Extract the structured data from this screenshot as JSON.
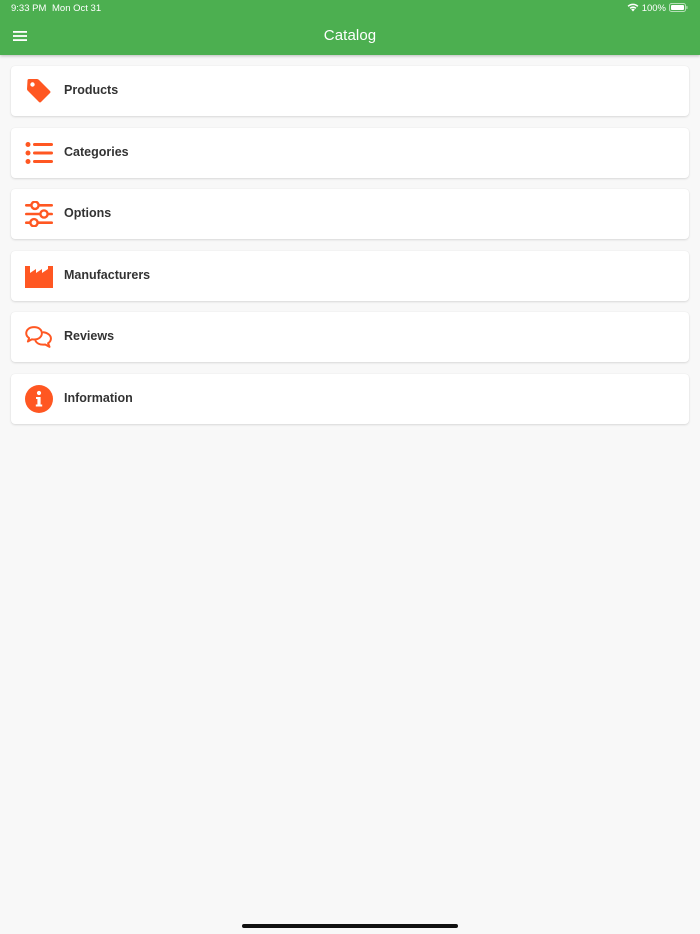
{
  "status_bar": {
    "time": "9:33 PM",
    "date": "Mon Oct 31",
    "battery": "100%",
    "icons": [
      "wifi-icon",
      "battery-icon"
    ]
  },
  "header": {
    "title": "Catalog",
    "menu_icon": "hamburger-menu-icon",
    "background_color": "#4caf50"
  },
  "accent_color": "#ff5722",
  "menu": {
    "items": [
      {
        "label": "Products",
        "icon": "tag-icon"
      },
      {
        "label": "Categories",
        "icon": "list-icon"
      },
      {
        "label": "Options",
        "icon": "sliders-icon"
      },
      {
        "label": "Manufacturers",
        "icon": "factory-icon"
      },
      {
        "label": "Reviews",
        "icon": "comments-icon"
      },
      {
        "label": "Information",
        "icon": "info-circle-icon"
      }
    ]
  }
}
